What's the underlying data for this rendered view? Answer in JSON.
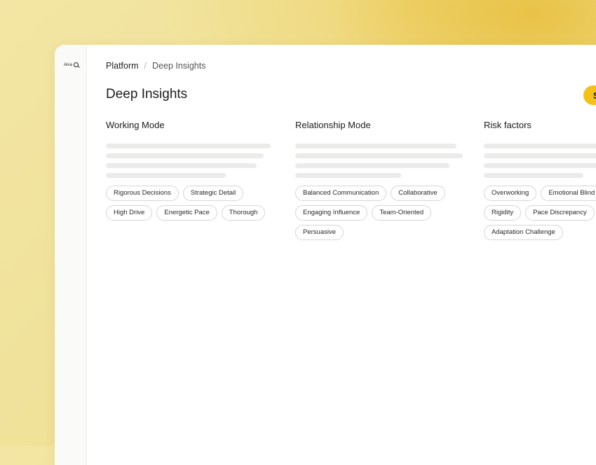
{
  "app": {
    "logo_text": "Alva"
  },
  "breadcrumb": {
    "root": "Platform",
    "separator": "/",
    "current": "Deep Insights"
  },
  "page": {
    "title": "Deep Insights",
    "action_label": "S"
  },
  "columns": [
    {
      "title": "Working Mode",
      "tags": [
        "Rigorous Decisions",
        "Strategic Detail",
        "High Drive",
        "Energetic Pace",
        "Thorough"
      ]
    },
    {
      "title": "Relationship Mode",
      "tags": [
        "Balanced Communication",
        "Collaborative",
        "Engaging Influence",
        "Team-Oriented",
        "Persuasive"
      ]
    },
    {
      "title": "Risk factors",
      "tags": [
        "Overworking",
        "Emotional Blind",
        "Rigidity",
        "Pace Discrepancy",
        "Adaptation Challenge"
      ]
    }
  ],
  "colors": {
    "accent": "#f5c018",
    "background_gradient": "#f0e29a",
    "skeleton": "#ebebea"
  }
}
